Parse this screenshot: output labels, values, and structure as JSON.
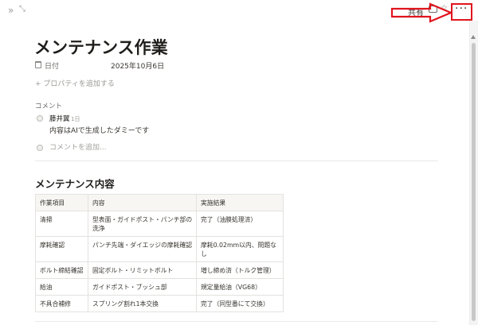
{
  "topbar": {
    "expand_icon": "double-chevron-right-icon",
    "fullscreen_icon": "expand-arrows-icon",
    "share_label": "共有",
    "comment_icon": "comment-icon",
    "star_icon": "star-icon",
    "more_label": "···"
  },
  "annotation": {
    "color": "#e0141e"
  },
  "page": {
    "title": "メンテナンス作業",
    "properties": [
      {
        "icon": "calendar-icon",
        "name": "日付",
        "value": "2025年10月6日"
      }
    ],
    "add_property_label": "+ プロパティを追加する"
  },
  "comments": {
    "label": "コメント",
    "items": [
      {
        "author": "藤井翼",
        "time": "1日",
        "body": "内容はAIで生成したダミーです"
      }
    ],
    "input_placeholder": "コメントを追加..."
  },
  "section": {
    "heading": "メンテナンス内容",
    "table": {
      "headers": [
        "作業項目",
        "内容",
        "実施結果"
      ],
      "rows": [
        [
          "清掃",
          "型表面・ガイドポスト・パンチ部の洗浄",
          "完了（油膜処理済）"
        ],
        [
          "摩耗確認",
          "パンチ先端・ダイエッジの摩耗確認",
          "摩耗0.02mm以内、問題なし"
        ],
        [
          "ボルト締結確認",
          "固定ボルト・リミットボルト",
          "増し締め済（トルク管理）"
        ],
        [
          "給油",
          "ガイドポスト・ブッシュ部",
          "規定量給油（VG68）"
        ],
        [
          "不具合補修",
          "スプリング割れ1本交換",
          "完了（同型番にて交換）"
        ]
      ]
    }
  }
}
